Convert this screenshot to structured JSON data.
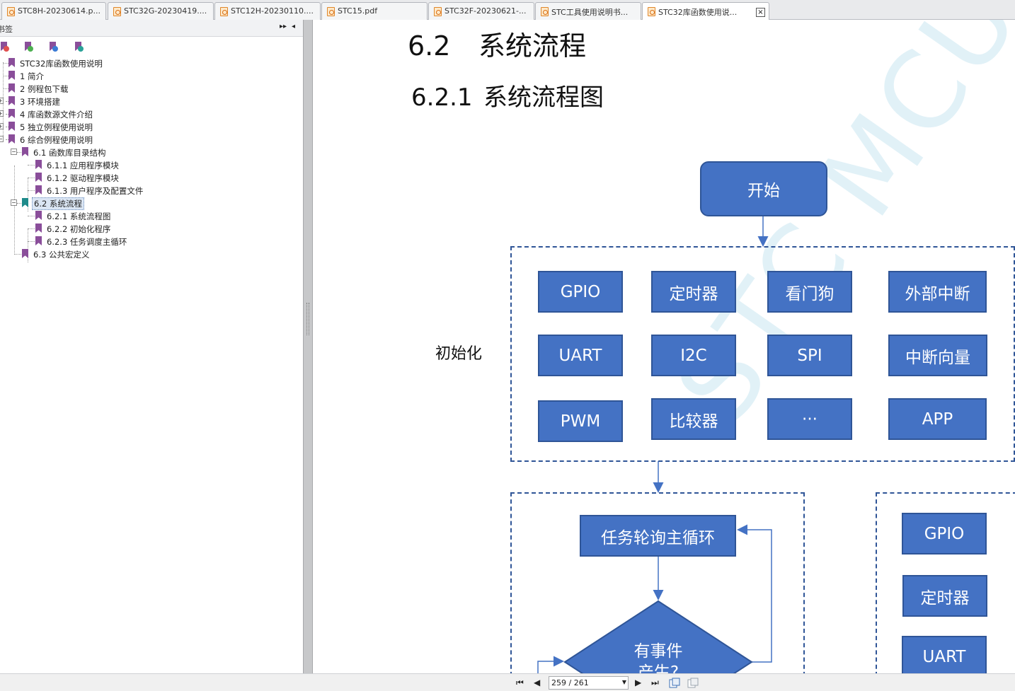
{
  "tabs": [
    {
      "label": "STC8H-20230614.p..."
    },
    {
      "label": "STC32G-20230419...."
    },
    {
      "label": "STC12H-20230110...."
    },
    {
      "label": "STC15.pdf"
    },
    {
      "label": "STC32F-20230621-..."
    },
    {
      "label": "STC工具使用说明书..."
    },
    {
      "label": "STC32库函数使用说..."
    }
  ],
  "tab_close": "×",
  "sidebar": {
    "title": "书签",
    "collapse_glyph": "▸▸",
    "close_glyph": "◂",
    "tree": [
      {
        "label": "STC32库函数使用说明"
      },
      {
        "label": "1 简介"
      },
      {
        "label": "2 例程包下载"
      },
      {
        "label": "3 环境搭建"
      },
      {
        "label": "4 库函数源文件介绍"
      },
      {
        "label": "5 独立例程使用说明"
      },
      {
        "label": "6 综合例程使用说明"
      },
      {
        "label": "6.1 函数库目录结构"
      },
      {
        "label": "6.1.1 应用程序模块"
      },
      {
        "label": "6.1.2 驱动程序模块"
      },
      {
        "label": "6.1.3 用户程序及配置文件"
      },
      {
        "label": "6.2 系统流程"
      },
      {
        "label": "6.2.1 系统流程图"
      },
      {
        "label": "6.2.2 初始化程序"
      },
      {
        "label": "6.2.3 任务调度主循环"
      },
      {
        "label": "6.3 公共宏定义"
      }
    ]
  },
  "document": {
    "heading2_num": "6.2",
    "heading2_text": "系统流程",
    "heading3_num": "6.2.1",
    "heading3_text": "系统流程图",
    "flow": {
      "start": "开始",
      "init_label": "初始化",
      "init_modules": [
        "GPIO",
        "定时器",
        "看门狗",
        "外部中断",
        "UART",
        "I2C",
        "SPI",
        "中断向量",
        "PWM",
        "比较器",
        "···",
        "APP"
      ],
      "main_loop": "任务轮询主循环",
      "decision": "有事件",
      "decision_line2": "产生?",
      "right_modules": [
        "GPIO",
        "定时器",
        "UART"
      ]
    },
    "watermark": "STC MCU"
  },
  "status": {
    "page_display": "259 / 261",
    "first_glyph": "⏮",
    "prev_glyph": "◀",
    "next_glyph": "▶",
    "last_glyph": "⏭"
  },
  "colors": {
    "flow_fill": "#4472c4",
    "flow_border": "#2f5597",
    "bookmark": "#8a4e9a",
    "bookmark_selected": "#1e8a8a"
  }
}
